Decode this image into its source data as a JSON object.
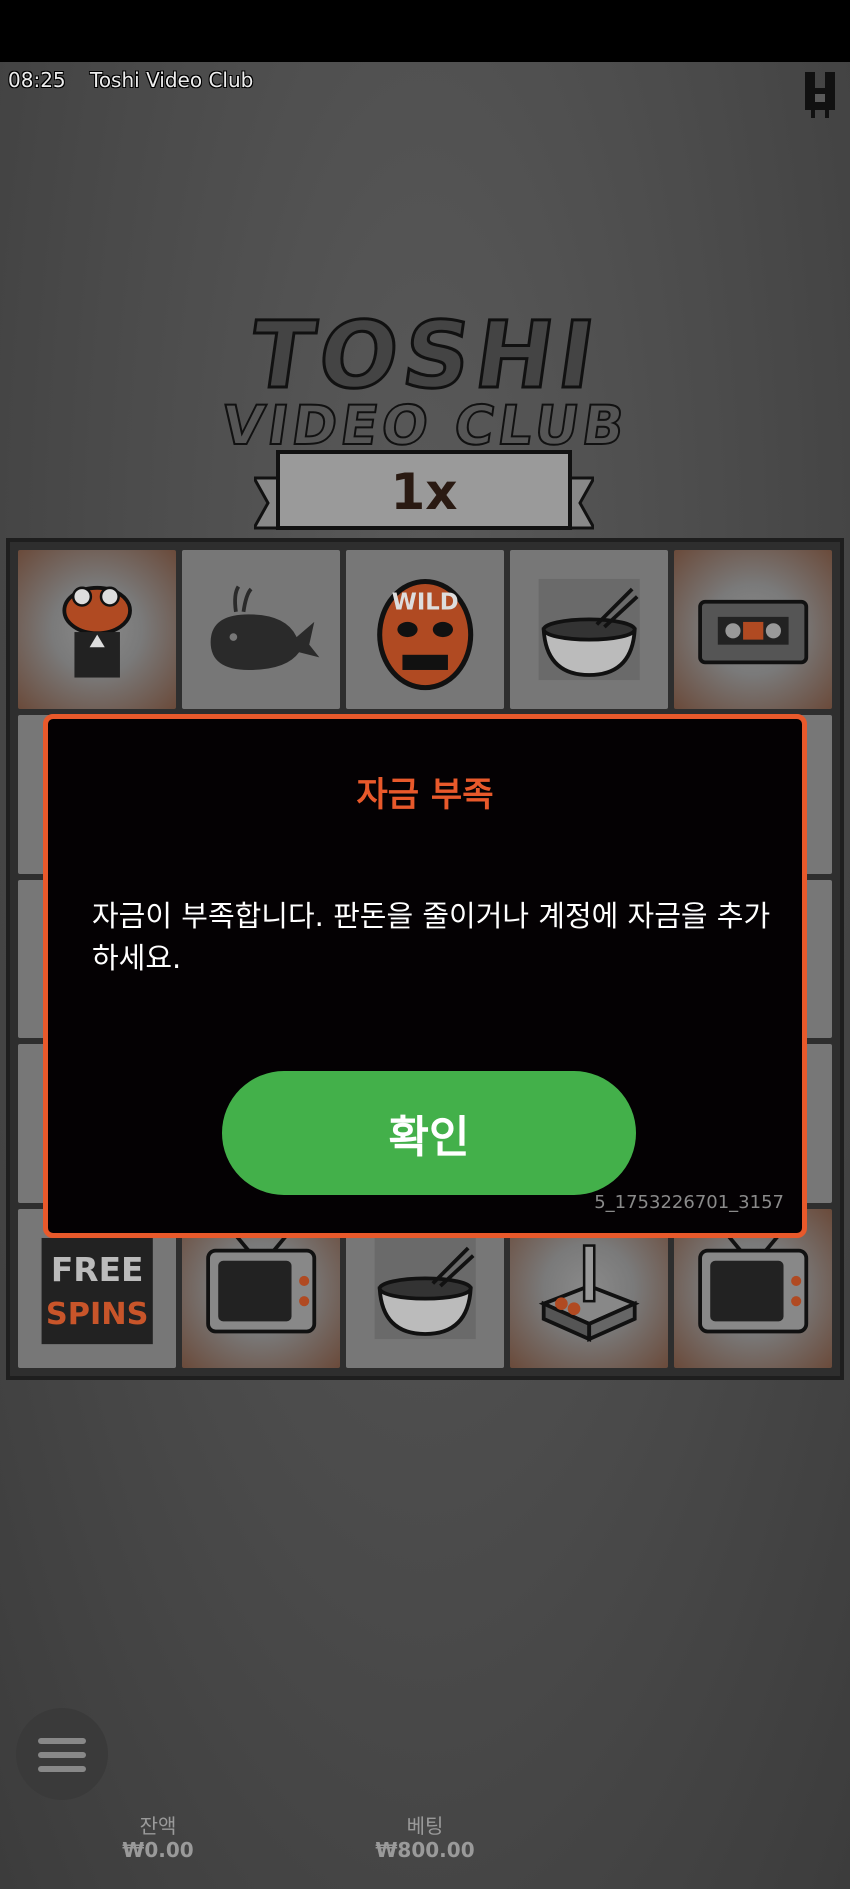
{
  "hud": {
    "time": "08:25",
    "game_title": "Toshi Video Club"
  },
  "logo": {
    "line1": "TOSHI",
    "line2": "VIDEO CLUB",
    "multiplier": "1x"
  },
  "reels": {
    "row1": [
      "frog-mascot-icon",
      "whale-icon",
      "wild-mask-icon",
      "noodle-bowl-icon",
      "vhs-tape-icon"
    ],
    "row5": [
      "free-spins-icon",
      "tv-icon",
      "noodle-bowl-icon",
      "joystick-icon",
      "tv-icon"
    ],
    "free_spins_label_1": "FREE",
    "free_spins_label_2": "SPINS",
    "wild_label": "WILD"
  },
  "dialog": {
    "title": "자금 부족",
    "message": "자금이 부족합니다. 판돈을 줄이거나 계정에 자금을 추가하세요.",
    "ok_label": "확인",
    "error_id": "5_1753226701_3157"
  },
  "footer": {
    "balance_label": "잔액",
    "balance_value": "₩0.00",
    "bet_label": "베팅",
    "bet_value": "₩800.00"
  },
  "colors": {
    "accent": "#e8592b",
    "ok_button": "#43b04a",
    "dialog_bg": "#040103"
  }
}
